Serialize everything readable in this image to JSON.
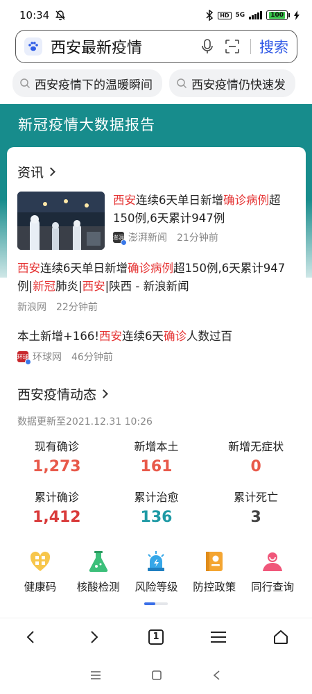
{
  "status_bar": {
    "time": "10:34",
    "network": "5G",
    "battery": "100"
  },
  "search": {
    "query": "西安最新疫情",
    "button_label": "搜索"
  },
  "suggestions": [
    "西安疫情下的温暖瞬间",
    "西安疫情仍快速发"
  ],
  "banner": {
    "title": "新冠疫情大数据报告"
  },
  "news_section": {
    "heading": "资讯",
    "items": [
      {
        "title_parts": [
          {
            "text": "西安",
            "hl": true
          },
          {
            "text": "连续6天单日新增",
            "hl": false
          },
          {
            "text": "确诊病例",
            "hl": true
          },
          {
            "text": "超150例,6天累计947例",
            "hl": false
          }
        ],
        "source": "澎湃新闻",
        "time": "21分钟前",
        "logo_text": "澎湃"
      },
      {
        "title_parts": [
          {
            "text": "西安",
            "hl": true
          },
          {
            "text": "连续6天单日新增",
            "hl": false
          },
          {
            "text": "确诊病例",
            "hl": true
          },
          {
            "text": "超150例,6天累计947例|",
            "hl": false
          },
          {
            "text": "新冠",
            "hl": true
          },
          {
            "text": "肺炎|",
            "hl": false
          },
          {
            "text": "西安",
            "hl": true
          },
          {
            "text": "|陕西 - 新浪新闻",
            "hl": false
          }
        ],
        "source": "新浪网",
        "time": "22分钟前"
      },
      {
        "title_parts": [
          {
            "text": "本土新增+166!",
            "hl": false
          },
          {
            "text": "西安",
            "hl": true
          },
          {
            "text": "连续6天",
            "hl": false
          },
          {
            "text": "确诊",
            "hl": true
          },
          {
            "text": "人数过百",
            "hl": false
          }
        ],
        "source": "环球网",
        "time": "46分钟前",
        "logo_text": "环球"
      }
    ]
  },
  "dynamics": {
    "heading": "西安疫情动态",
    "update_text": "数据更新至2021.12.31 10:26",
    "stats": [
      {
        "label": "现有确诊",
        "value": "1,273",
        "color": "#e8594a"
      },
      {
        "label": "新增本土",
        "value": "161",
        "color": "#e8594a"
      },
      {
        "label": "新增无症状",
        "value": "0",
        "color": "#e8594a"
      },
      {
        "label": "累计确诊",
        "value": "1,412",
        "color": "#d93a3a"
      },
      {
        "label": "累计治愈",
        "value": "136",
        "color": "#1f9aa5"
      },
      {
        "label": "累计死亡",
        "value": "3",
        "color": "#444444"
      }
    ]
  },
  "tools": [
    {
      "label": "健康码",
      "icon": "health-code-icon"
    },
    {
      "label": "核酸检测",
      "icon": "flask-icon"
    },
    {
      "label": "风险等级",
      "icon": "alarm-light-icon"
    },
    {
      "label": "防控政策",
      "icon": "policy-book-icon"
    },
    {
      "label": "同行查询",
      "icon": "person-search-icon"
    }
  ],
  "browser_nav": {
    "tab_count": "1"
  }
}
